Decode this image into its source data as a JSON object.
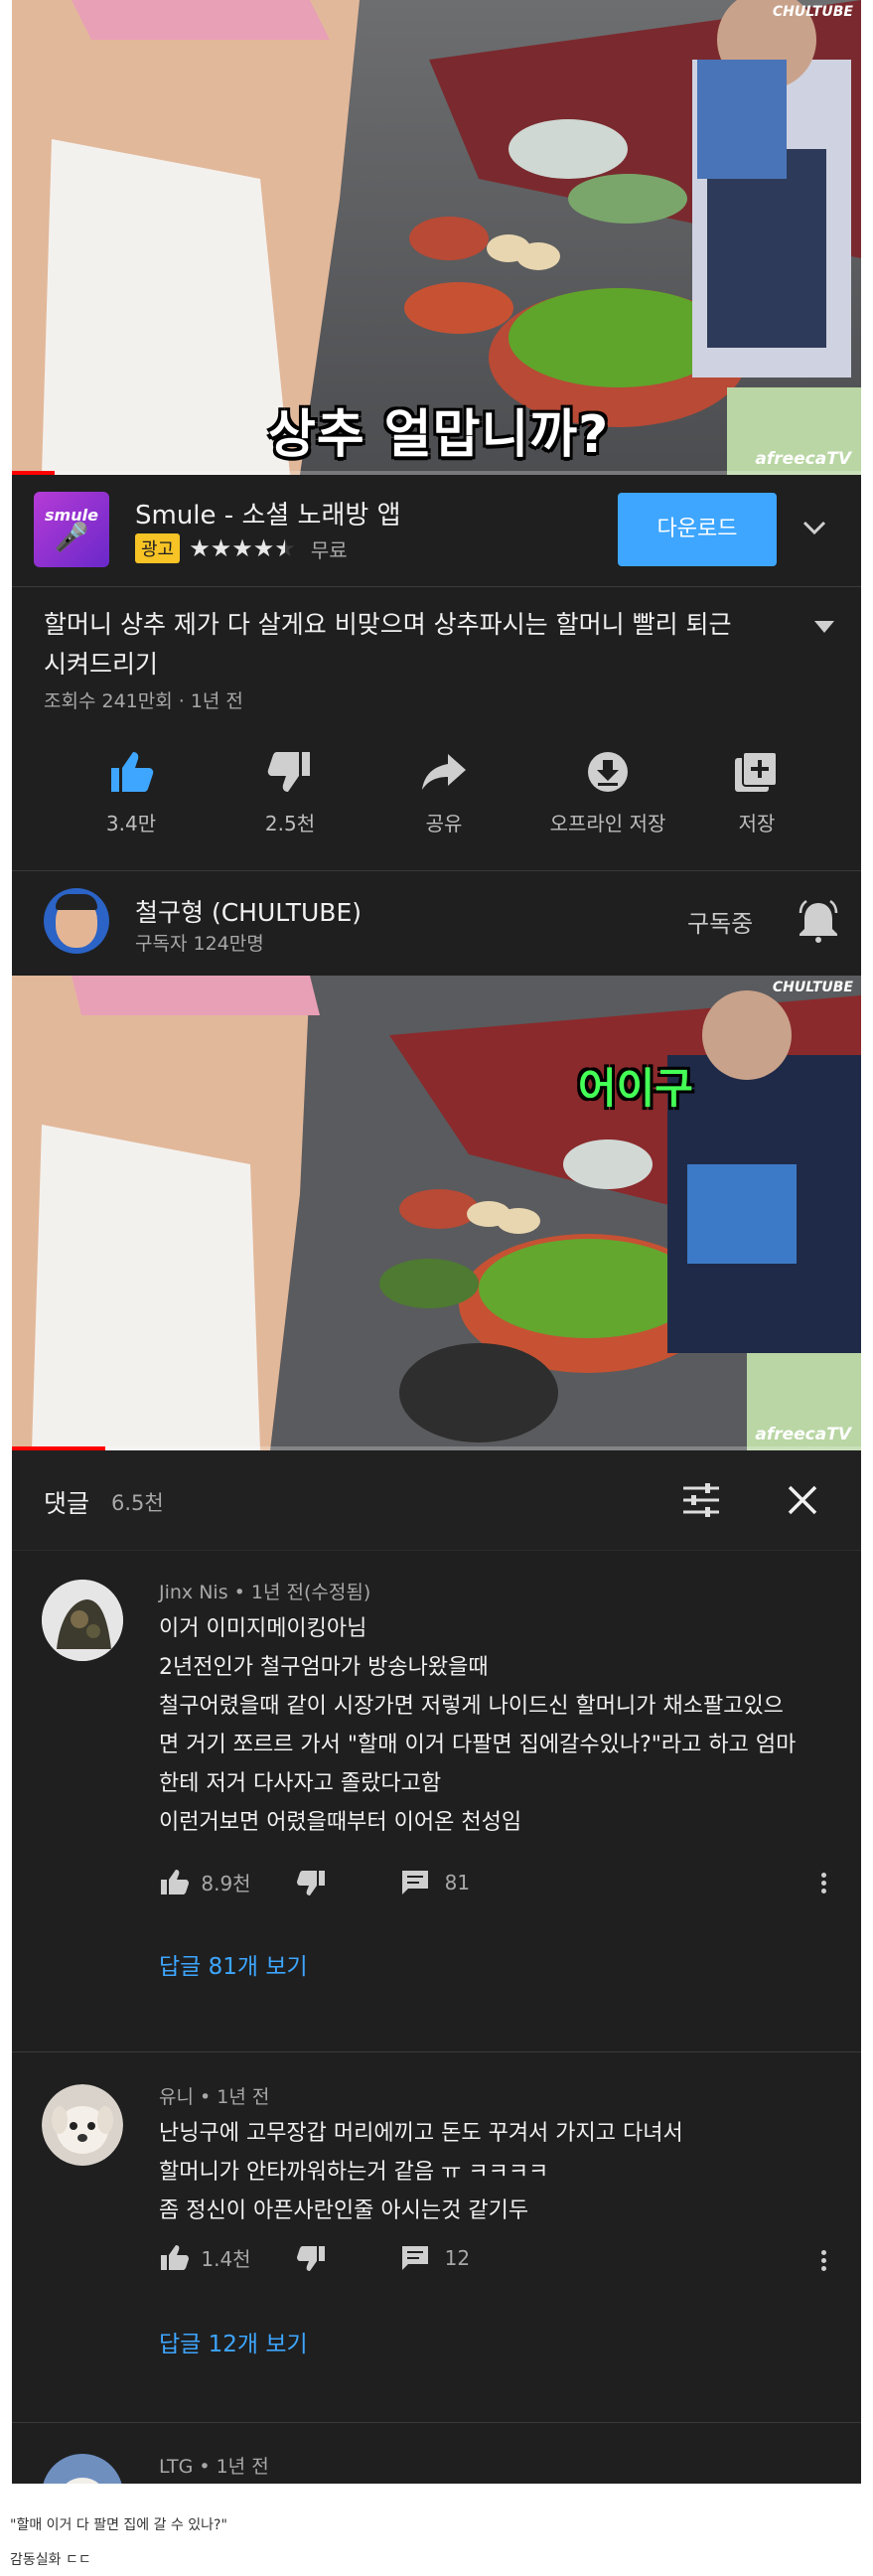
{
  "video1": {
    "caption": "상추 얼맙니까?",
    "brand_tag": "CHULTUBE",
    "watermark": "afreecaTV",
    "progress": 0.05
  },
  "ad": {
    "title": "Smule - 소셜 노래방 앱",
    "badge": "광고",
    "rating": 4.5,
    "stars": "★★★★★",
    "price": "무료",
    "button": "다운로드",
    "chevron_icon": "chevron-down-icon",
    "accent": "#3ea6ff"
  },
  "video_info": {
    "title_line1": "할머니 상추 제가 다 살게요 비맞으며 상추파시는 할머니 빨리 퇴근",
    "title_line2": "시켜드리기",
    "meta": "조회수 241만회 · 1년 전"
  },
  "actions": [
    {
      "icon": "thumbs-up-icon",
      "label": "3.4만"
    },
    {
      "icon": "thumbs-down-icon",
      "label": "2.5천"
    },
    {
      "icon": "share-icon",
      "label": "공유"
    },
    {
      "icon": "download-icon",
      "label": "오프라인 저장"
    },
    {
      "icon": "playlist-add-icon",
      "label": "저장"
    }
  ],
  "channel": {
    "name": "철구형 (CHULTUBE)",
    "subscribers": "구독자 124만명",
    "subscribed_label": "구독중",
    "bell_icon": "bell-icon"
  },
  "video2": {
    "caption": "어이구",
    "brand_tag": "CHULTUBE",
    "watermark": "afreecaTV",
    "progress": 0.11
  },
  "comments_header": {
    "title": "댓글",
    "count": "6.5천",
    "sort_icon": "sort-icon",
    "close_icon": "close-icon"
  },
  "comments": [
    {
      "author": "Jinx Nis",
      "meta": " • 1년 전(수정됨)",
      "lines": [
        "이거 이미지메이킹아님",
        "2년전인가 철구엄마가 방송나왔을때",
        "철구어렸을때 같이 시장가면 저렇게 나이드신 할머니가 채소팔고있으",
        "면 거기 쪼르르 가서 \"할매 이거 다팔면 집에갈수있나?\"라고 하고 엄마",
        "한테 저거 다사자고 졸랐다고함",
        "이런거보면 어렸을때부터 이어온 천성임"
      ],
      "likes": "8.9천",
      "replies": "81",
      "reply_link": "답글 81개 보기"
    },
    {
      "author": "유니",
      "meta": " • 1년 전",
      "lines": [
        "난닝구에 고무장갑 머리에끼고 돈도 꾸겨서 가지고 다녀서",
        "할머니가 안타까워하는거 같음 ㅠ ㅋㅋㅋㅋ",
        "좀 정신이 아픈사란인줄 아시는것 같기두"
      ],
      "likes": "1.4천",
      "replies": "12",
      "reply_link": "답글 12개 보기"
    },
    {
      "author": "LTG",
      "meta": " • 1년 전"
    }
  ],
  "footer": {
    "quote": "\"할매 이거 다 팔면 집에 갈 수 있나?\"",
    "note": "감동실화 ㄷㄷ"
  }
}
